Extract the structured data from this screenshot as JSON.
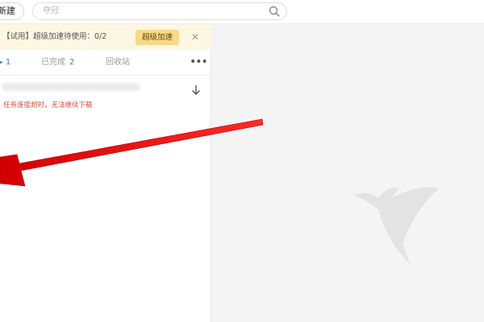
{
  "toolbar": {
    "new_label": "新建",
    "search_placeholder": "夺冠",
    "search_icon": "search-icon"
  },
  "notice": {
    "text": "【试用】超级加速待使用：0/2",
    "boost_label": "超级加速",
    "close_glyph": "✕"
  },
  "tabs": {
    "downloading_count": "1",
    "completed_label": "已完成",
    "completed_count": "2",
    "recycle_label": "回收站",
    "more_glyph": "•••"
  },
  "task": {
    "error_text": "任务连接超时，无法继续下载"
  },
  "colors": {
    "accent": "#2d7fe0",
    "error": "#e24a3a",
    "notice_bg": "#fdf6e2",
    "boost_bg": "#f6d98a",
    "annotation": "#e60000"
  },
  "icons": {
    "logo": "hummingbird-logo-icon",
    "download": "download-arrow-icon",
    "annotation": "red-arrow-annotation"
  }
}
